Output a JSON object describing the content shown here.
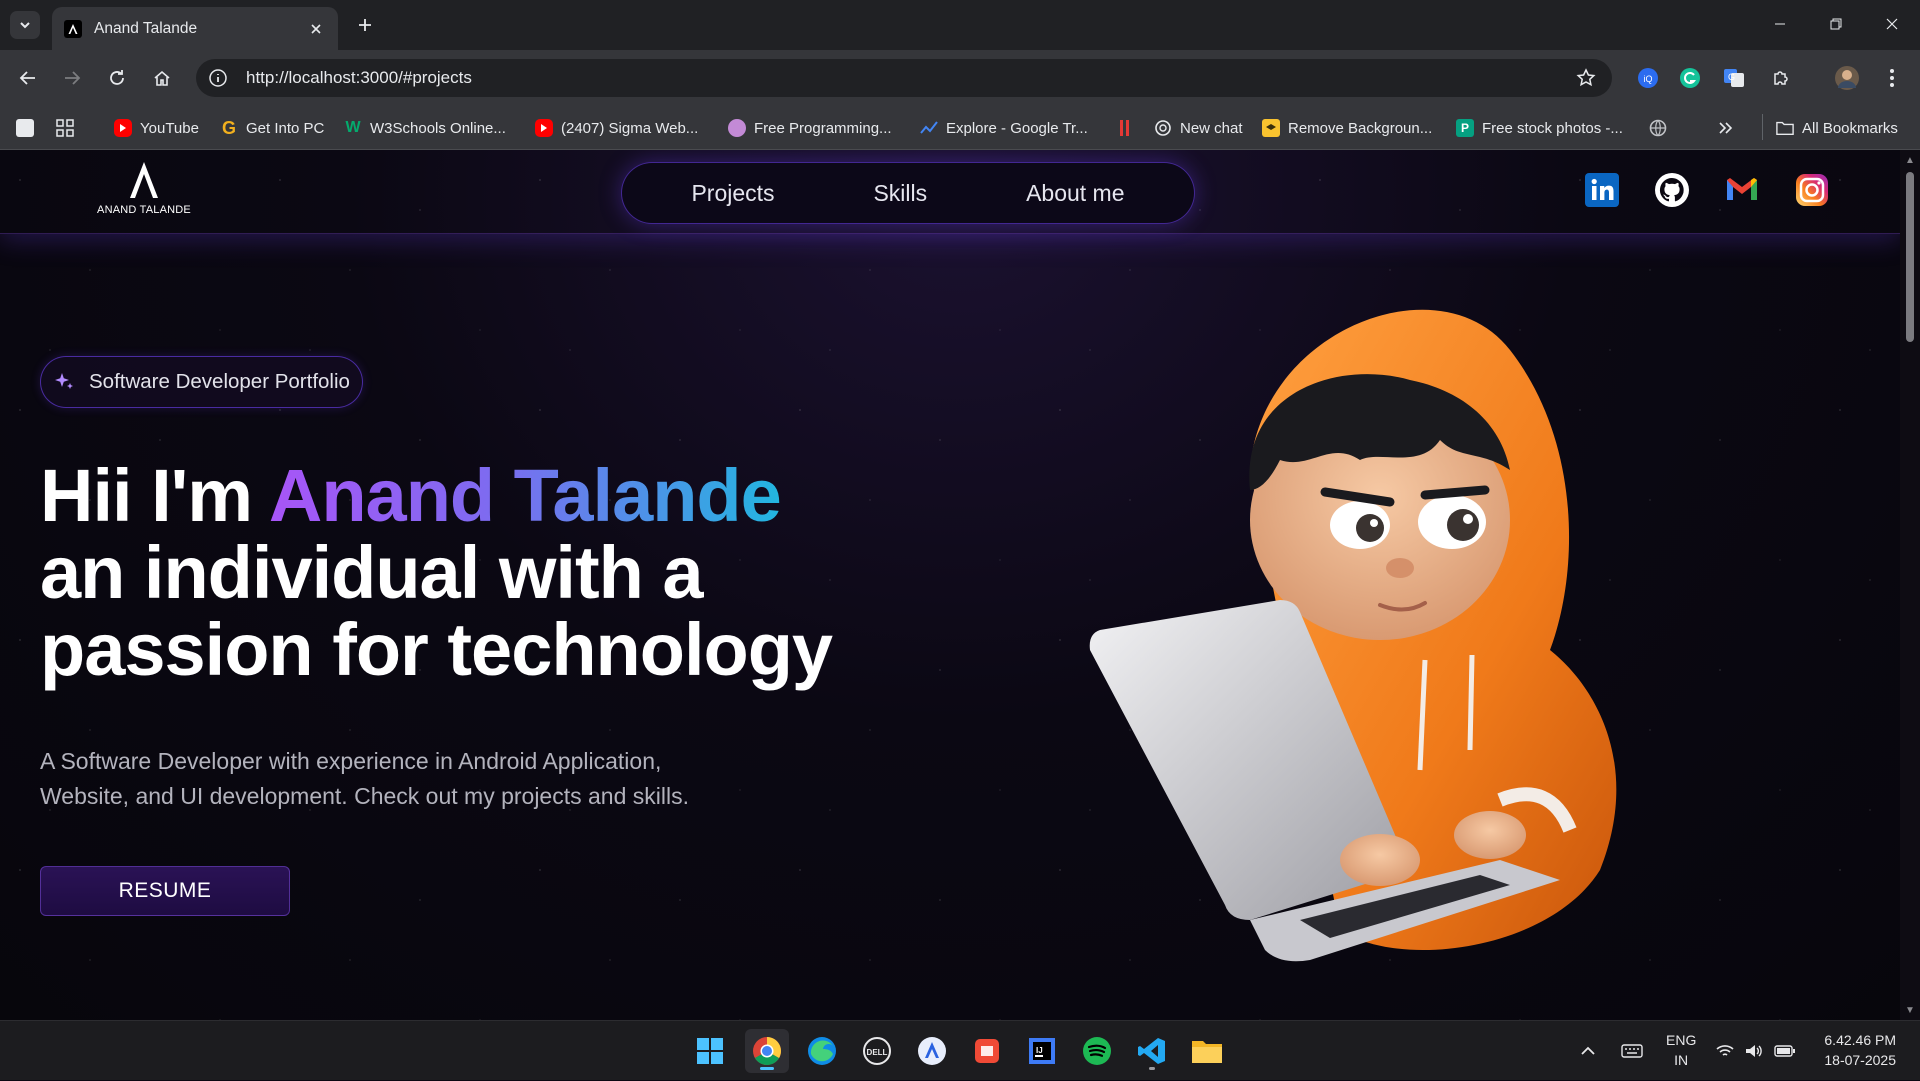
{
  "browser": {
    "tab_title": "Anand Talande",
    "url": "http://localhost:3000/#projects",
    "bookmarks": [
      {
        "label": "YouTube"
      },
      {
        "label": "Get Into PC"
      },
      {
        "label": "W3Schools Online..."
      },
      {
        "label": "(2407) Sigma Web..."
      },
      {
        "label": "Free Programming..."
      },
      {
        "label": "Explore - Google Tr..."
      },
      {
        "label": "New chat"
      },
      {
        "label": "Remove Backgroun..."
      },
      {
        "label": "Free stock photos -..."
      }
    ],
    "all_bookmarks": "All Bookmarks"
  },
  "site": {
    "logo_text": "ANAND TALANDE",
    "nav": [
      {
        "label": "Projects"
      },
      {
        "label": "Skills"
      },
      {
        "label": "About me"
      }
    ],
    "socials": [
      "linkedin-icon",
      "github-icon",
      "gmail-icon",
      "instagram-icon"
    ],
    "badge": "Software Developer Portfolio",
    "headline_prefix": "Hii I'm ",
    "headline_name": "Anand Talande",
    "headline_line2": "an individual with a",
    "headline_line3": "passion for technology",
    "subtext_line1": "A Software Developer with experience in Android Application,",
    "subtext_line2": "Website, and UI development. Check out my projects and skills.",
    "resume_label": "RESUME",
    "colors": {
      "accent_purple": "#a855f7",
      "accent_cyan": "#22b6e0",
      "hoodie": "#f07a1a"
    }
  },
  "taskbar": {
    "apps": [
      "windows-start-icon",
      "chrome-icon",
      "edge-icon",
      "dell-icon",
      "app-store-icon",
      "office-icon",
      "intellij-icon",
      "spotify-icon",
      "vscode-icon",
      "file-explorer-icon"
    ],
    "lang_top": "ENG",
    "lang_bottom": "IN",
    "time": "6.42.46 PM",
    "date": "18-07-2025"
  }
}
